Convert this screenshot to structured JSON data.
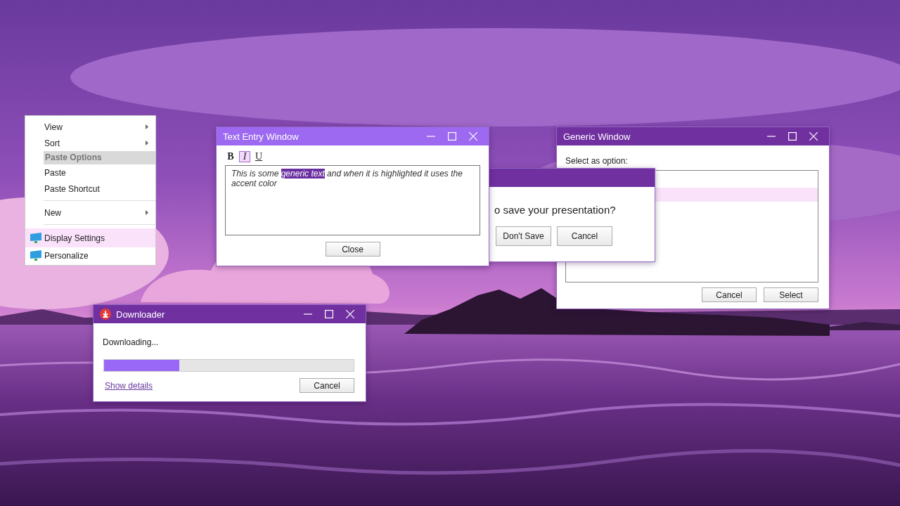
{
  "context_menu": {
    "items": [
      {
        "kind": "item",
        "label": "View",
        "submenu": true,
        "icon": false,
        "selected": false
      },
      {
        "kind": "item",
        "label": "Sort",
        "submenu": true,
        "icon": false,
        "selected": false
      },
      {
        "kind": "header",
        "label": "Paste Options"
      },
      {
        "kind": "item",
        "label": "Paste",
        "submenu": false,
        "icon": false,
        "selected": false
      },
      {
        "kind": "item",
        "label": "Paste Shortcut",
        "submenu": false,
        "icon": false,
        "selected": false
      },
      {
        "kind": "separator"
      },
      {
        "kind": "item",
        "label": "New",
        "submenu": true,
        "icon": false,
        "selected": false
      },
      {
        "kind": "separator"
      },
      {
        "kind": "item",
        "label": "Display Settings",
        "submenu": false,
        "icon": true,
        "selected": true
      },
      {
        "kind": "item",
        "label": "Personalize",
        "submenu": false,
        "icon": true,
        "selected": false
      }
    ]
  },
  "generic_window": {
    "title": "Generic Window",
    "active": false,
    "prompt": "Select as option:",
    "list": [
      {
        "selected": false
      },
      {
        "selected": true
      }
    ],
    "buttons": [
      "Cancel",
      "Select"
    ]
  },
  "save_dialog": {
    "active": false,
    "message": "o save your presentation?",
    "buttons": [
      "Don't Save",
      "Cancel"
    ]
  },
  "text_entry_window": {
    "title": "Text Entry Window",
    "active": true,
    "toolbar": [
      {
        "kind": "bold",
        "label": "B",
        "selected": false
      },
      {
        "kind": "italic",
        "label": "I",
        "selected": true
      },
      {
        "kind": "underline",
        "label": "U",
        "selected": false
      }
    ],
    "text": [
      {
        "text": "This is some ",
        "highlighted": false
      },
      {
        "text": "generic text",
        "highlighted": true
      },
      {
        "text": " and when it  is highlighted it uses the accent color",
        "highlighted": false
      }
    ],
    "button": "Close"
  },
  "downloader": {
    "title": "Downloader",
    "active": false,
    "status": "Downloading...",
    "progress": {
      "level": 0.3
    },
    "link": "Show details",
    "button": "Cancel"
  }
}
